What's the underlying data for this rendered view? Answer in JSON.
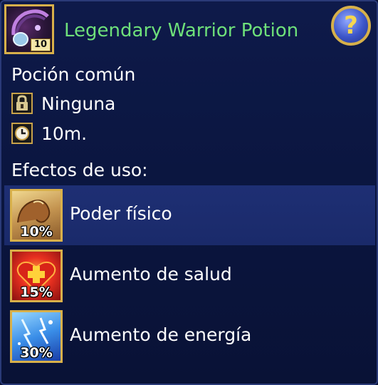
{
  "item": {
    "title": "Legendary Warrior Potion",
    "quantity": "10",
    "icon": "potion-flask-icon",
    "title_color": "#6ee07a"
  },
  "help": {
    "label": "?"
  },
  "details": {
    "rarity": "Poción común",
    "binding": "Ninguna",
    "binding_icon": "lock-icon",
    "duration": "10m.",
    "duration_icon": "clock-icon"
  },
  "effects": {
    "heading": "Efectos de uso:",
    "items": [
      {
        "label": "Poder físico",
        "percent": "10%",
        "icon": "muscle-arm-icon"
      },
      {
        "label": "Aumento de salud",
        "percent": "15%",
        "icon": "heart-cross-icon"
      },
      {
        "label": "Aumento de energía",
        "percent": "30%",
        "icon": "energy-sparkle-icon"
      }
    ]
  }
}
